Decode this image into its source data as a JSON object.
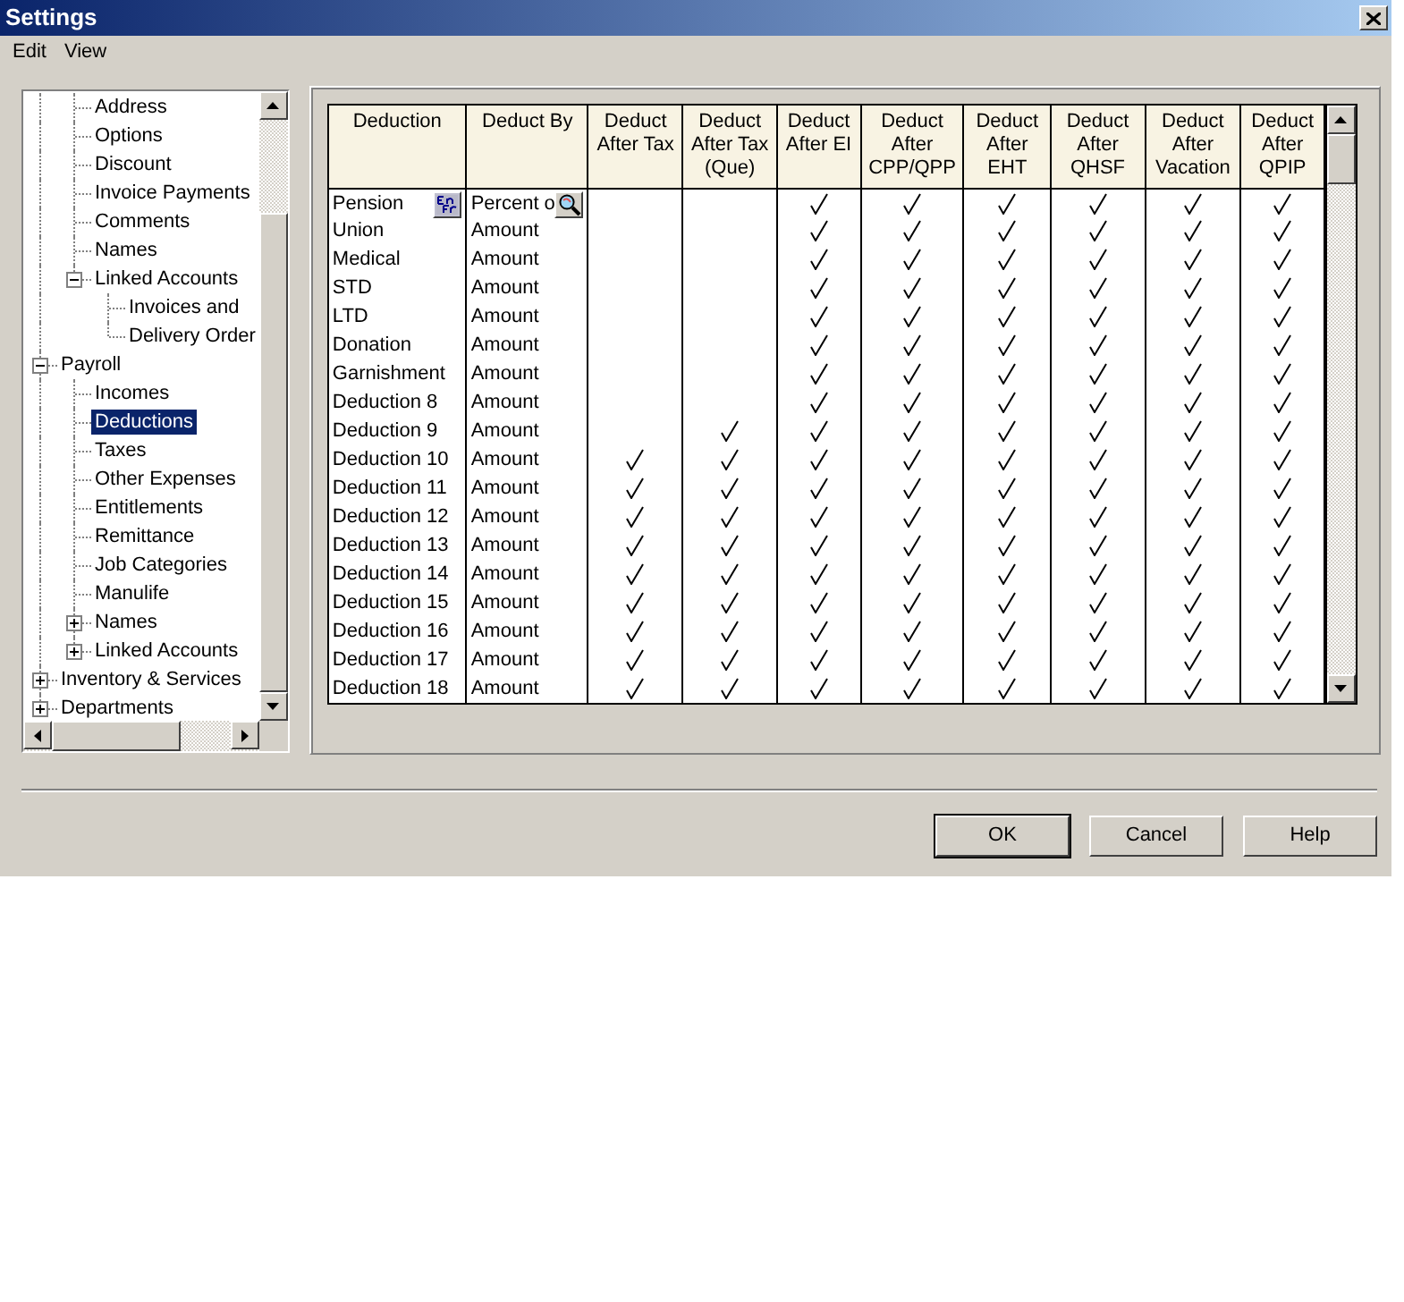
{
  "window": {
    "title": "Settings"
  },
  "menu": [
    "Edit",
    "View"
  ],
  "tree": {
    "items": [
      {
        "children": [
          {
            "label": "Address",
            "selected": false
          },
          {
            "label": "Options",
            "selected": false
          },
          {
            "label": "Discount",
            "selected": false
          },
          {
            "label": "Invoice Payments",
            "selected": false
          },
          {
            "label": "Comments",
            "selected": false
          },
          {
            "label": "Names",
            "selected": false
          },
          {
            "label": "Linked Accounts",
            "selected": false,
            "expanded": true,
            "children": [
              {
                "label": "Invoices and",
                "selected": false
              },
              {
                "label": "Delivery Order",
                "selected": false
              }
            ]
          }
        ]
      },
      {
        "label": "Payroll",
        "selected": false,
        "expanded": true,
        "children": [
          {
            "label": "Incomes",
            "selected": false
          },
          {
            "label": "Deductions",
            "selected": true
          },
          {
            "label": "Taxes",
            "selected": false
          },
          {
            "label": "Other Expenses",
            "selected": false
          },
          {
            "label": "Entitlements",
            "selected": false
          },
          {
            "label": "Remittance",
            "selected": false
          },
          {
            "label": "Job Categories",
            "selected": false
          },
          {
            "label": "Manulife",
            "selected": false
          },
          {
            "label": "Names",
            "selected": false,
            "expanded": false
          },
          {
            "label": "Linked Accounts",
            "selected": false,
            "expanded": false
          }
        ]
      },
      {
        "label": "Inventory & Services",
        "selected": false,
        "expanded": false
      },
      {
        "label": "Departments",
        "selected": false,
        "expanded": false
      }
    ]
  },
  "table": {
    "columns": [
      "Deduction",
      "Deduct By",
      "Deduct After Tax",
      "Deduct After Tax (Que)",
      "Deduct After EI",
      "Deduct After CPP/QPP",
      "Deduct After EHT",
      "Deduct After QHSF",
      "Deduct After Vacation",
      "Deduct After QPIP"
    ],
    "rows": [
      {
        "name": "Pension",
        "deduct_by": "Percent o",
        "checked": [
          false,
          false,
          true,
          true,
          true,
          true,
          true,
          true
        ]
      },
      {
        "name": "Union",
        "deduct_by": "Amount",
        "checked": [
          false,
          false,
          true,
          true,
          true,
          true,
          true,
          true
        ]
      },
      {
        "name": "Medical",
        "deduct_by": "Amount",
        "checked": [
          false,
          false,
          true,
          true,
          true,
          true,
          true,
          true
        ]
      },
      {
        "name": "STD",
        "deduct_by": "Amount",
        "checked": [
          false,
          false,
          true,
          true,
          true,
          true,
          true,
          true
        ]
      },
      {
        "name": "LTD",
        "deduct_by": "Amount",
        "checked": [
          false,
          false,
          true,
          true,
          true,
          true,
          true,
          true
        ]
      },
      {
        "name": "Donation",
        "deduct_by": "Amount",
        "checked": [
          false,
          false,
          true,
          true,
          true,
          true,
          true,
          true
        ]
      },
      {
        "name": "Garnishment",
        "deduct_by": "Amount",
        "checked": [
          false,
          false,
          true,
          true,
          true,
          true,
          true,
          true
        ]
      },
      {
        "name": "Deduction 8",
        "deduct_by": "Amount",
        "checked": [
          false,
          false,
          true,
          true,
          true,
          true,
          true,
          true
        ]
      },
      {
        "name": "Deduction 9",
        "deduct_by": "Amount",
        "checked": [
          false,
          true,
          true,
          true,
          true,
          true,
          true,
          true
        ]
      },
      {
        "name": "Deduction 10",
        "deduct_by": "Amount",
        "checked": [
          true,
          true,
          true,
          true,
          true,
          true,
          true,
          true
        ]
      },
      {
        "name": "Deduction 11",
        "deduct_by": "Amount",
        "checked": [
          true,
          true,
          true,
          true,
          true,
          true,
          true,
          true
        ]
      },
      {
        "name": "Deduction 12",
        "deduct_by": "Amount",
        "checked": [
          true,
          true,
          true,
          true,
          true,
          true,
          true,
          true
        ]
      },
      {
        "name": "Deduction 13",
        "deduct_by": "Amount",
        "checked": [
          true,
          true,
          true,
          true,
          true,
          true,
          true,
          true
        ]
      },
      {
        "name": "Deduction 14",
        "deduct_by": "Amount",
        "checked": [
          true,
          true,
          true,
          true,
          true,
          true,
          true,
          true
        ]
      },
      {
        "name": "Deduction 15",
        "deduct_by": "Amount",
        "checked": [
          true,
          true,
          true,
          true,
          true,
          true,
          true,
          true
        ]
      },
      {
        "name": "Deduction 16",
        "deduct_by": "Amount",
        "checked": [
          true,
          true,
          true,
          true,
          true,
          true,
          true,
          true
        ]
      },
      {
        "name": "Deduction 17",
        "deduct_by": "Amount",
        "checked": [
          true,
          true,
          true,
          true,
          true,
          true,
          true,
          true
        ]
      },
      {
        "name": "Deduction 18",
        "deduct_by": "Amount",
        "checked": [
          true,
          true,
          true,
          true,
          true,
          true,
          true,
          true
        ]
      }
    ]
  },
  "buttons": [
    {
      "label": "OK",
      "default": true
    },
    {
      "label": "Cancel",
      "default": false
    },
    {
      "label": "Help",
      "default": false
    }
  ]
}
